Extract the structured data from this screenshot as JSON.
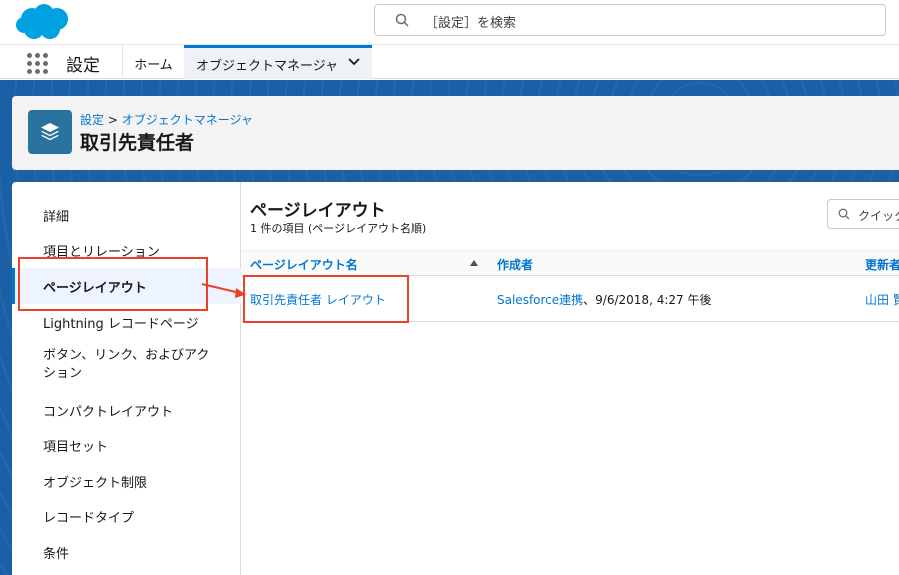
{
  "header": {
    "search_placeholder": "［設定］を検索"
  },
  "nav": {
    "app_name": "設定",
    "tabs": [
      {
        "label": "ホーム"
      },
      {
        "label": "オブジェクトマネージャ"
      }
    ]
  },
  "page_header": {
    "breadcrumb_root": "設定",
    "breadcrumb_sep": " > ",
    "breadcrumb_current": "オブジェクトマネージャ",
    "title": "取引先責任者"
  },
  "sidebar": {
    "items": [
      {
        "label": "詳細"
      },
      {
        "label": "項目とリレーション"
      },
      {
        "label": "ページレイアウト"
      },
      {
        "label": "Lightning レコードページ"
      },
      {
        "label": "ボタン、リンク、およびアクション"
      },
      {
        "label": "コンパクトレイアウト"
      },
      {
        "label": "項目セット"
      },
      {
        "label": "オブジェクト制限"
      },
      {
        "label": "レコードタイプ"
      },
      {
        "label": "条件"
      }
    ]
  },
  "content": {
    "title": "ページレイアウト",
    "subtitle": "1 件の項目 (ページレイアウト名順)",
    "quick_find_placeholder": "クイック",
    "columns": [
      "ページレイアウト名",
      "作成者",
      "更新者"
    ],
    "rows": [
      {
        "name": "取引先責任者 レイアウト",
        "created_by_user": "Salesforce連携",
        "created_by_date": "、9/6/2018, 4:27 午後",
        "modified_by": "山田 賢"
      }
    ]
  },
  "colors": {
    "brand_blue": "#0176d3",
    "annotation_red": "#e8412c",
    "object_icon": "#2a739e"
  }
}
